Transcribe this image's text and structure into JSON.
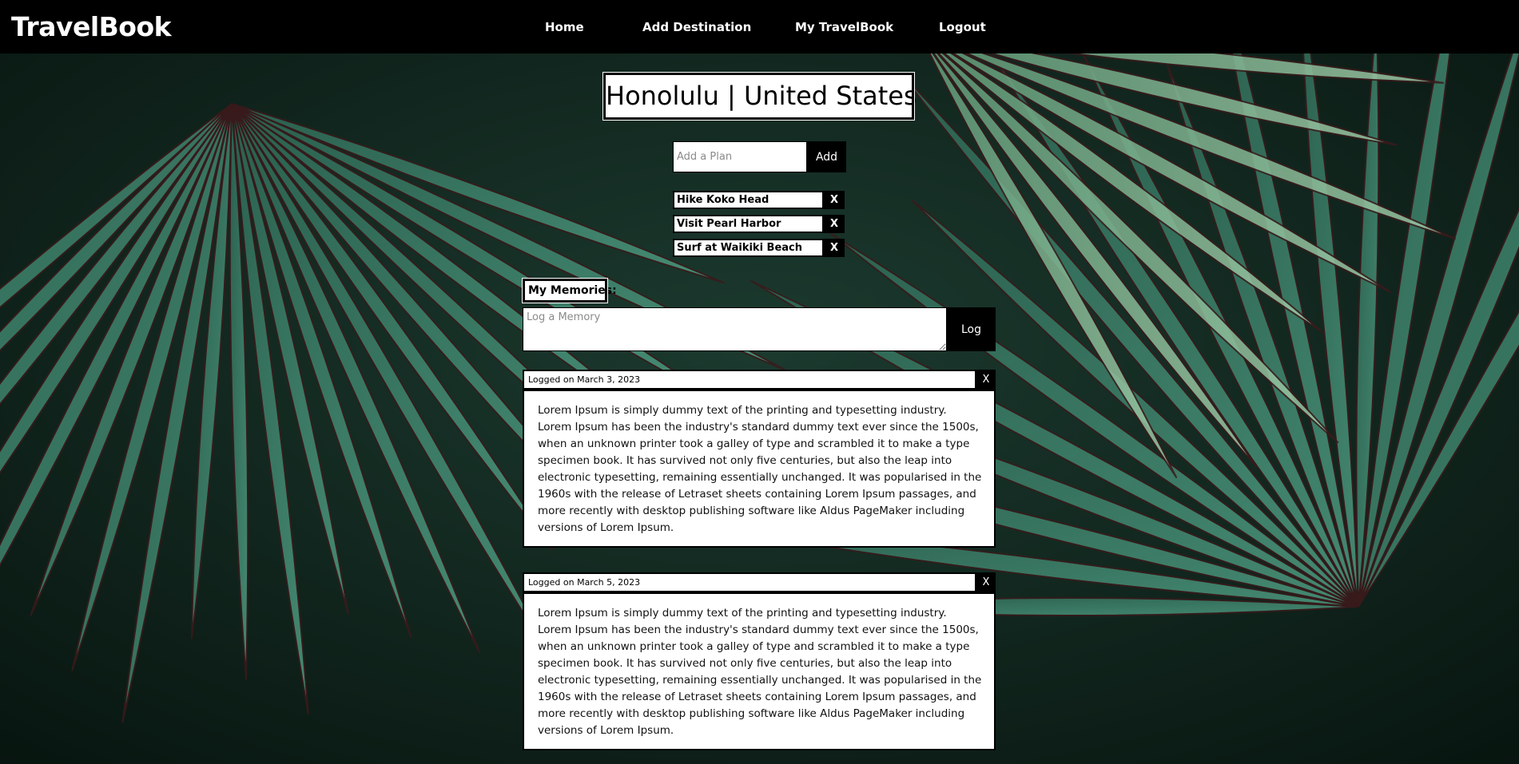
{
  "app": {
    "brand": "TravelBook"
  },
  "nav": {
    "items": [
      {
        "label": "Home"
      },
      {
        "label": "Add Destination"
      },
      {
        "label": "My TravelBook"
      },
      {
        "label": "Logout"
      }
    ]
  },
  "destination": {
    "title": "Honolulu | United States"
  },
  "plan_form": {
    "placeholder": "Add a Plan",
    "value": "",
    "add_label": "Add"
  },
  "plans": [
    {
      "text": "Hike Koko Head",
      "remove_label": "X"
    },
    {
      "text": "Visit Pearl Harbor",
      "remove_label": "X"
    },
    {
      "text": "Surf at Waikiki Beach",
      "remove_label": "X"
    }
  ],
  "memories": {
    "label": "My Memories:",
    "input_placeholder": "Log a Memory",
    "input_value": "",
    "log_label": "Log",
    "entries": [
      {
        "date": "Logged on March 3, 2023",
        "delete_label": "X",
        "text": "Lorem Ipsum is simply dummy text of the printing and typesetting industry. Lorem Ipsum has been the industry's standard dummy text ever since the 1500s, when an unknown printer took a galley of type and scrambled it to make a type specimen book. It has survived not only five centuries, but also the leap into electronic typesetting, remaining essentially unchanged. It was popularised in the 1960s with the release of Letraset sheets containing Lorem Ipsum passages, and more recently with desktop publishing software like Aldus PageMaker including versions of Lorem Ipsum."
      },
      {
        "date": "Logged on March 5, 2023",
        "delete_label": "X",
        "text": "Lorem Ipsum is simply dummy text of the printing and typesetting industry. Lorem Ipsum has been the industry's standard dummy text ever since the 1500s, when an unknown printer took a galley of type and scrambled it to make a type specimen book. It has survived not only five centuries, but also the leap into electronic typesetting, remaining essentially unchanged. It was popularised in the 1960s with the release of Letraset sheets containing Lorem Ipsum passages, and more recently with desktop publishing software like Aldus PageMaker including versions of Lorem Ipsum."
      }
    ]
  },
  "colors": {
    "navbar": "#000000",
    "background_dark": "#0b1a14",
    "leaf_green": "#3f8f74",
    "leaf_light": "#8fbf98",
    "leaf_stripe": "#3a1a1c",
    "accent_button": "#000000",
    "card_bg": "#ffffff"
  }
}
